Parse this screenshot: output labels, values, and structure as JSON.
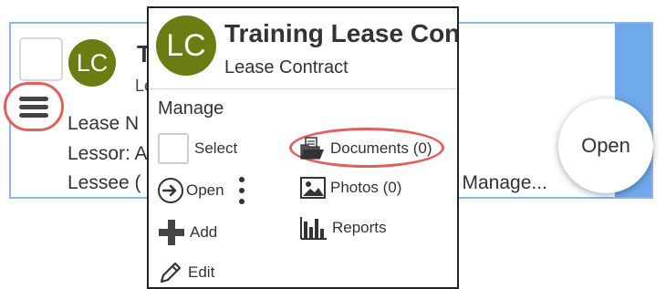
{
  "card": {
    "avatar_initials": "LC",
    "title_fragment": "T",
    "subtitle_fragment": "Le",
    "line_lease_no": "Lease N",
    "line_lessor": "Lessor: A",
    "line_lessee": "Lessee (",
    "line_lessee_tail": "l Manage..."
  },
  "open_bubble": {
    "label": "Open"
  },
  "hamburger": {
    "icon": "menu-icon"
  },
  "popup": {
    "avatar_initials": "LC",
    "title": "Training Lease Cont",
    "subtitle": "Lease Contract",
    "section_heading": "Manage",
    "items": {
      "select": {
        "label": "Select"
      },
      "open": {
        "label": "Open",
        "icon": "arrow-circle-right-icon"
      },
      "more": {
        "icon": "kebab-icon"
      },
      "add": {
        "label": "Add",
        "icon": "plus-icon"
      },
      "edit": {
        "label": "Edit",
        "icon": "pencil-icon"
      },
      "documents": {
        "label": "Documents (0)",
        "icon": "folder-document-icon"
      },
      "photos": {
        "label": "Photos (0)",
        "icon": "photo-icon"
      },
      "reports": {
        "label": "Reports",
        "icon": "bar-chart-icon"
      }
    }
  },
  "colors": {
    "avatar_bg": "#6b7d12",
    "highlight_ring": "#e06060",
    "card_border": "#8fb5e6",
    "card_accent": "#6ea9ea"
  }
}
